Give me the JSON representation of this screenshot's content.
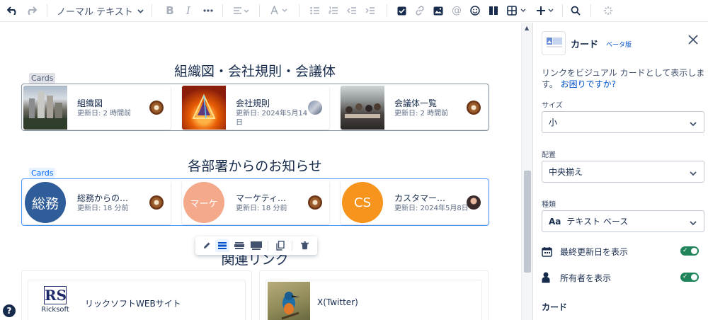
{
  "toolbar": {
    "text_style": "ノーマル テキスト"
  },
  "editor": {
    "sections": [
      {
        "heading": "組織図・会社規則・会議体",
        "tag": "Cards",
        "cards": [
          {
            "title": "組織図",
            "meta": "更新日: 2 時間前"
          },
          {
            "title": "会社規則",
            "meta": "更新日: 2024年5月14日"
          },
          {
            "title": "会議体一覧",
            "meta": "更新日: 2 時間前"
          }
        ]
      },
      {
        "heading": "各部署からのお知らせ",
        "tag": "Cards",
        "cards": [
          {
            "title": "総務からの…",
            "meta": "更新日: 18 分前",
            "thumb_text": "総務",
            "thumb_color": "#2f5d99"
          },
          {
            "title": "マーケティ…",
            "meta": "更新日: 18 分前",
            "thumb_text": "マーケ",
            "thumb_color": "#f4a98b"
          },
          {
            "title": "カスタマー…",
            "meta": "更新日: 2024年5月8日",
            "thumb_text": "CS",
            "thumb_color": "#f7941d"
          }
        ]
      }
    ],
    "related_heading": "関連リンク",
    "link_cards": [
      {
        "title": "リックソフトWEBサイト",
        "logo_main": "RS",
        "logo_sub": "Ricksoft"
      },
      {
        "title": "X(Twitter)"
      }
    ],
    "help": "?"
  },
  "panel": {
    "title": "カード",
    "beta": "ベータ版",
    "description": "リンクをビジュアル カードとして表示します。",
    "help_link": "お困りですか?",
    "size_label": "サイズ",
    "size_value": "小",
    "align_label": "配置",
    "align_value": "中央揃え",
    "type_label": "種類",
    "type_icon": "Aa",
    "type_value": "テキスト ベース",
    "show_updated": "最終更新日を表示",
    "show_owner": "所有者を表示",
    "section_cards": "カード"
  },
  "colors": {
    "accent": "#0052cc",
    "toggle_on": "#1f845a"
  }
}
